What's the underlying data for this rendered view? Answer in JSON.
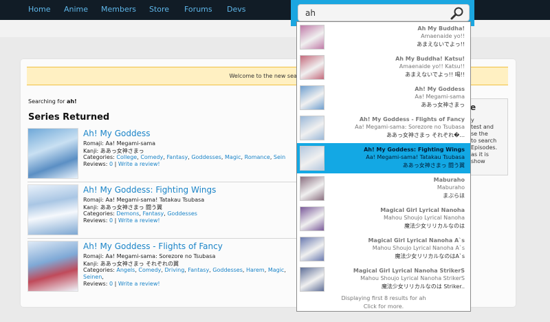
{
  "nav": {
    "items": [
      "Home",
      "Anime",
      "Members",
      "Store",
      "Forums",
      "Devs"
    ]
  },
  "welcome_text": "Welcome to the new search",
  "searching": {
    "prefix": "Searching for",
    "term": "ah!"
  },
  "series_heading": "Series Returned",
  "results": [
    {
      "title": "Ah! My Goddess",
      "romaji_label": "Romaji:",
      "romaji": "Aa! Megami-sama",
      "kanji_label": "Kanji:",
      "kanji": "ああっ女神さまっ",
      "categories_label": "Categories:",
      "categories": [
        "College",
        "Comedy",
        "Fantasy",
        "Goddesses",
        "Magic",
        "Romance",
        "Sein"
      ],
      "reviews_label": "Reviews:",
      "reviews": "0",
      "write_review": "Write a review!"
    },
    {
      "title": "Ah! My Goddess: Fighting Wings",
      "romaji_label": "Romaji:",
      "romaji": "Aa! Megami-sama! Tatakau Tsubasa",
      "kanji_label": "Kanji:",
      "kanji": "ああっ女神さまっ 闘う翼",
      "categories_label": "Categories:",
      "categories": [
        "Demons",
        "Fantasy",
        "Goddesses"
      ],
      "reviews_label": "Reviews:",
      "reviews": "0",
      "write_review": "Write a review!"
    },
    {
      "title": "Ah! My Goddess - Flights of Fancy",
      "romaji_label": "Romaji:",
      "romaji": "Aa! Megami-sama: Sorezore no Tsubasa",
      "kanji_label": "Kanji:",
      "kanji": "ああっ女神さまっ それぞれの翼",
      "categories_label": "Categories:",
      "categories": [
        "Angels",
        "Comedy",
        "Driving",
        "Fantasy",
        "Goddesses",
        "Harem",
        "Magic",
        "Seinen"
      ],
      "reviews_label": "Reviews:",
      "reviews": "0",
      "write_review": "Write a review!"
    }
  ],
  "side_panel": {
    "title": "e",
    "text": "y\ntest and\nse the\nto search\nEpisodes.\nas it is\nshow"
  },
  "search": {
    "value": "ah"
  },
  "suggestions": [
    {
      "line1": "Ah My Buddha!",
      "line2": "Amaenaide yo!!",
      "line3": "あまえないでよっ!!",
      "thumb": "#c07aa8"
    },
    {
      "line1": "Ah My Buddha! Katsu!",
      "line2": "Amaenaide yo!! Katsu!!",
      "line3": "あまえないでよっ!! 喝!!",
      "thumb": "#c46a7c"
    },
    {
      "line1": "Ah! My Goddess",
      "line2": "Aa! Megami-sama",
      "line3": "ああっ女神さまっ",
      "thumb": "#6f9fcf"
    },
    {
      "line1": "Ah! My Goddess - Flights of Fancy",
      "line2": "Aa! Megami-sama: Sorezore no Tsubasa",
      "line3": "ああっ女神さまっ それぞれ�...",
      "thumb": "#9ab8d8"
    },
    {
      "line1": "Ah! My Goddess: Fighting Wings",
      "line2": "Aa! Megami-sama! Tatakau Tsubasa",
      "line3": "ああっ女神さまっ 闘う翼",
      "thumb": "#b4c8e0"
    },
    {
      "line1": "Maburaho",
      "line2": "Maburaho",
      "line3": "まぶらほ",
      "thumb": "#8a6f80"
    },
    {
      "line1": "Magical Girl Lyrical Nanoha",
      "line2": "Mahou Shoujo Lyrical Nanoha",
      "line3": "魔法少女リリカルなのは",
      "thumb": "#7a5a9a"
    },
    {
      "line1": "Magical Girl Lyrical Nanoha A`s",
      "line2": "Mahou Shoujo Lyrical Nanoha A`s",
      "line3": "魔法少女リリカルなのはA`s",
      "thumb": "#6a7ab0"
    },
    {
      "line1": "Magical Girl Lyrical Nanoha StrikerS",
      "line2": "Mahou Shoujo Lyrical Nanoha StrikerS",
      "line3": "魔法少女リリカルなのは Striker..",
      "thumb": "#5f6f98"
    }
  ],
  "active_suggestion": 4,
  "dropdown_footer": {
    "line1": "Displaying first 8 results for ah",
    "line2": "Click for more."
  }
}
